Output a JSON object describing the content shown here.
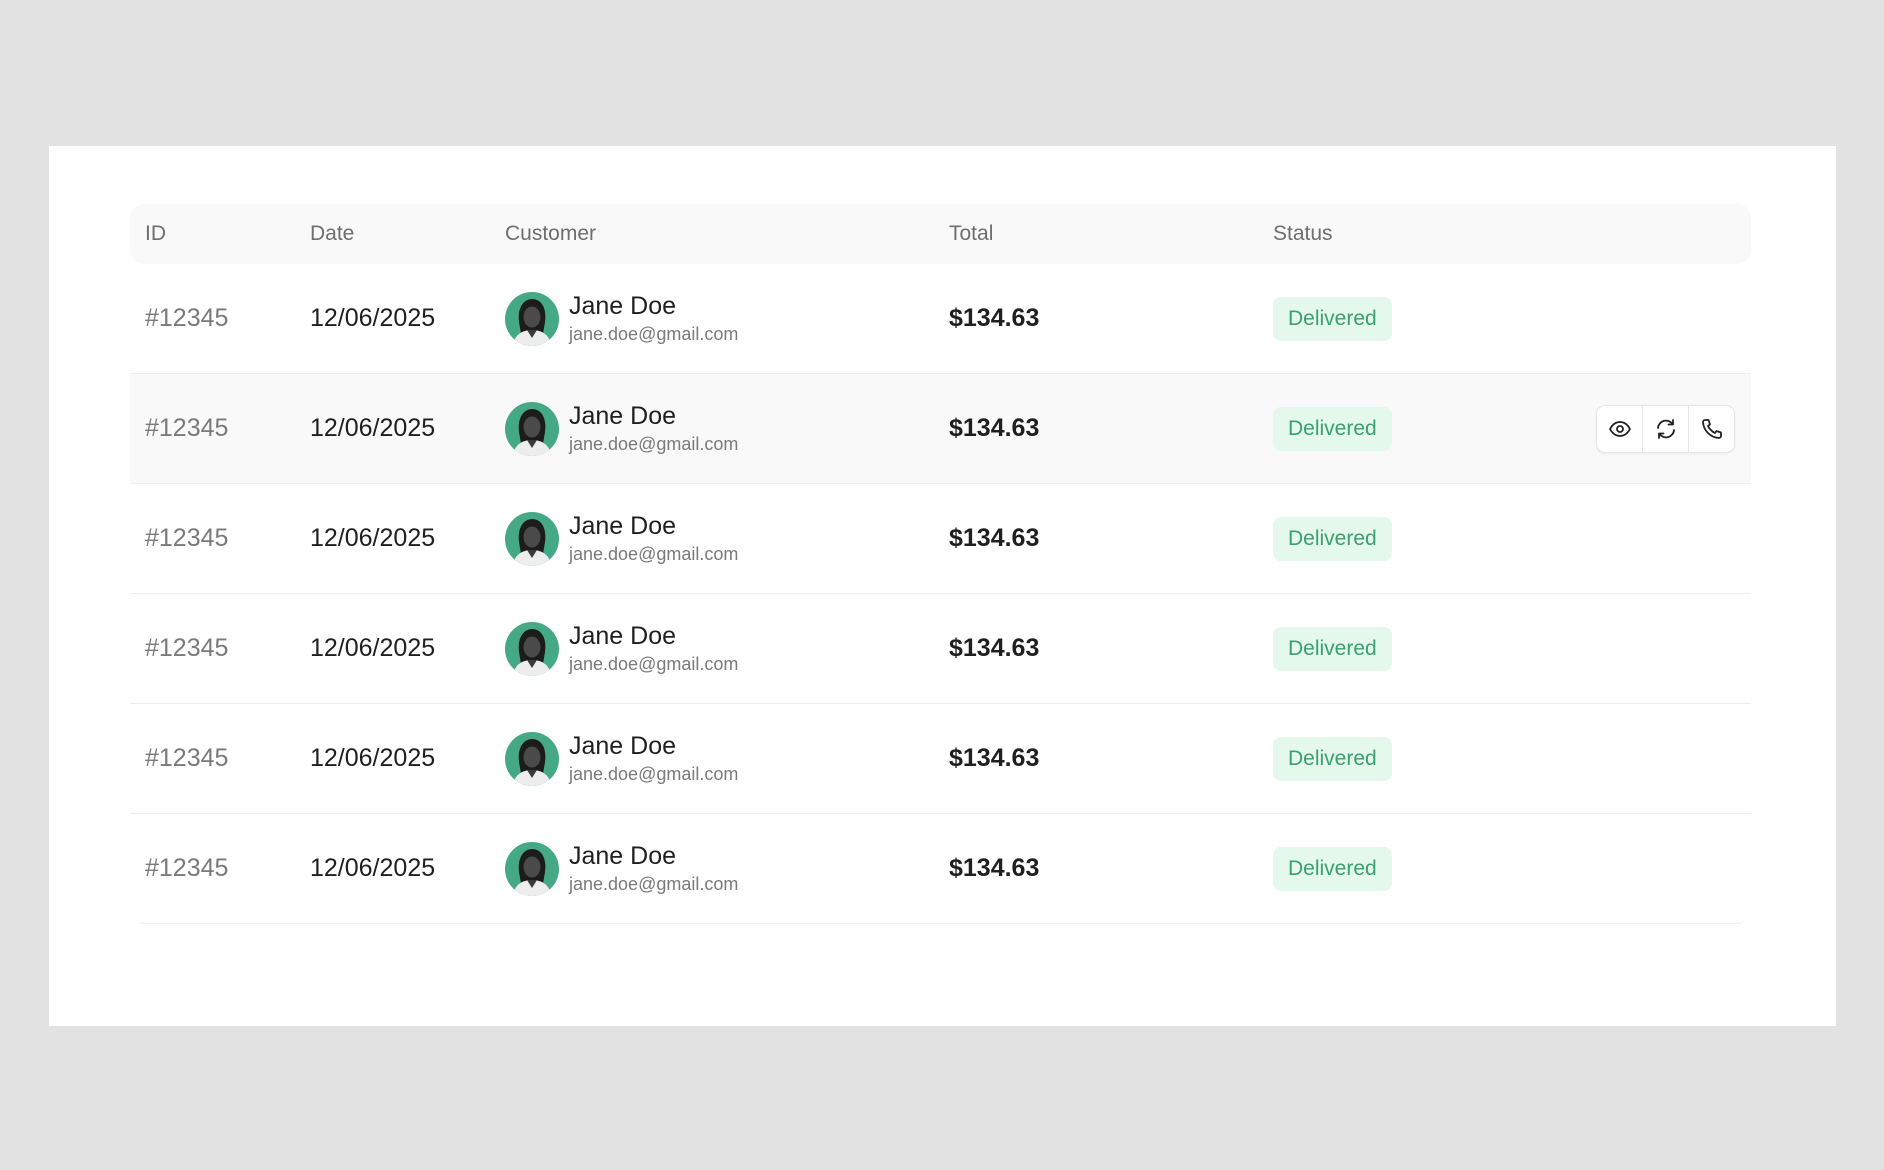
{
  "table": {
    "headers": {
      "id": "ID",
      "date": "Date",
      "customer": "Customer",
      "total": "Total",
      "status": "Status"
    },
    "rows": [
      {
        "id": "#12345",
        "date": "12/06/2025",
        "name": "Jane Doe",
        "email": "jane.doe@gmail.com",
        "total": "$134.63",
        "status": "Delivered"
      },
      {
        "id": "#12345",
        "date": "12/06/2025",
        "name": "Jane Doe",
        "email": "jane.doe@gmail.com",
        "total": "$134.63",
        "status": "Delivered"
      },
      {
        "id": "#12345",
        "date": "12/06/2025",
        "name": "Jane Doe",
        "email": "jane.doe@gmail.com",
        "total": "$134.63",
        "status": "Delivered"
      },
      {
        "id": "#12345",
        "date": "12/06/2025",
        "name": "Jane Doe",
        "email": "jane.doe@gmail.com",
        "total": "$134.63",
        "status": "Delivered"
      },
      {
        "id": "#12345",
        "date": "12/06/2025",
        "name": "Jane Doe",
        "email": "jane.doe@gmail.com",
        "total": "$134.63",
        "status": "Delivered"
      },
      {
        "id": "#12345",
        "date": "12/06/2025",
        "name": "Jane Doe",
        "email": "jane.doe@gmail.com",
        "total": "$134.63",
        "status": "Delivered"
      }
    ]
  },
  "row_actions": {
    "visible_on_row": 1,
    "icons": [
      "eye-icon",
      "refresh-icon",
      "phone-icon"
    ]
  },
  "colors": {
    "page_background": "#e2e2e2",
    "card_background": "#ffffff",
    "status_badge_background": "#e4f8ec",
    "status_badge_text": "#3aa16e",
    "avatar_background": "#46a985"
  }
}
